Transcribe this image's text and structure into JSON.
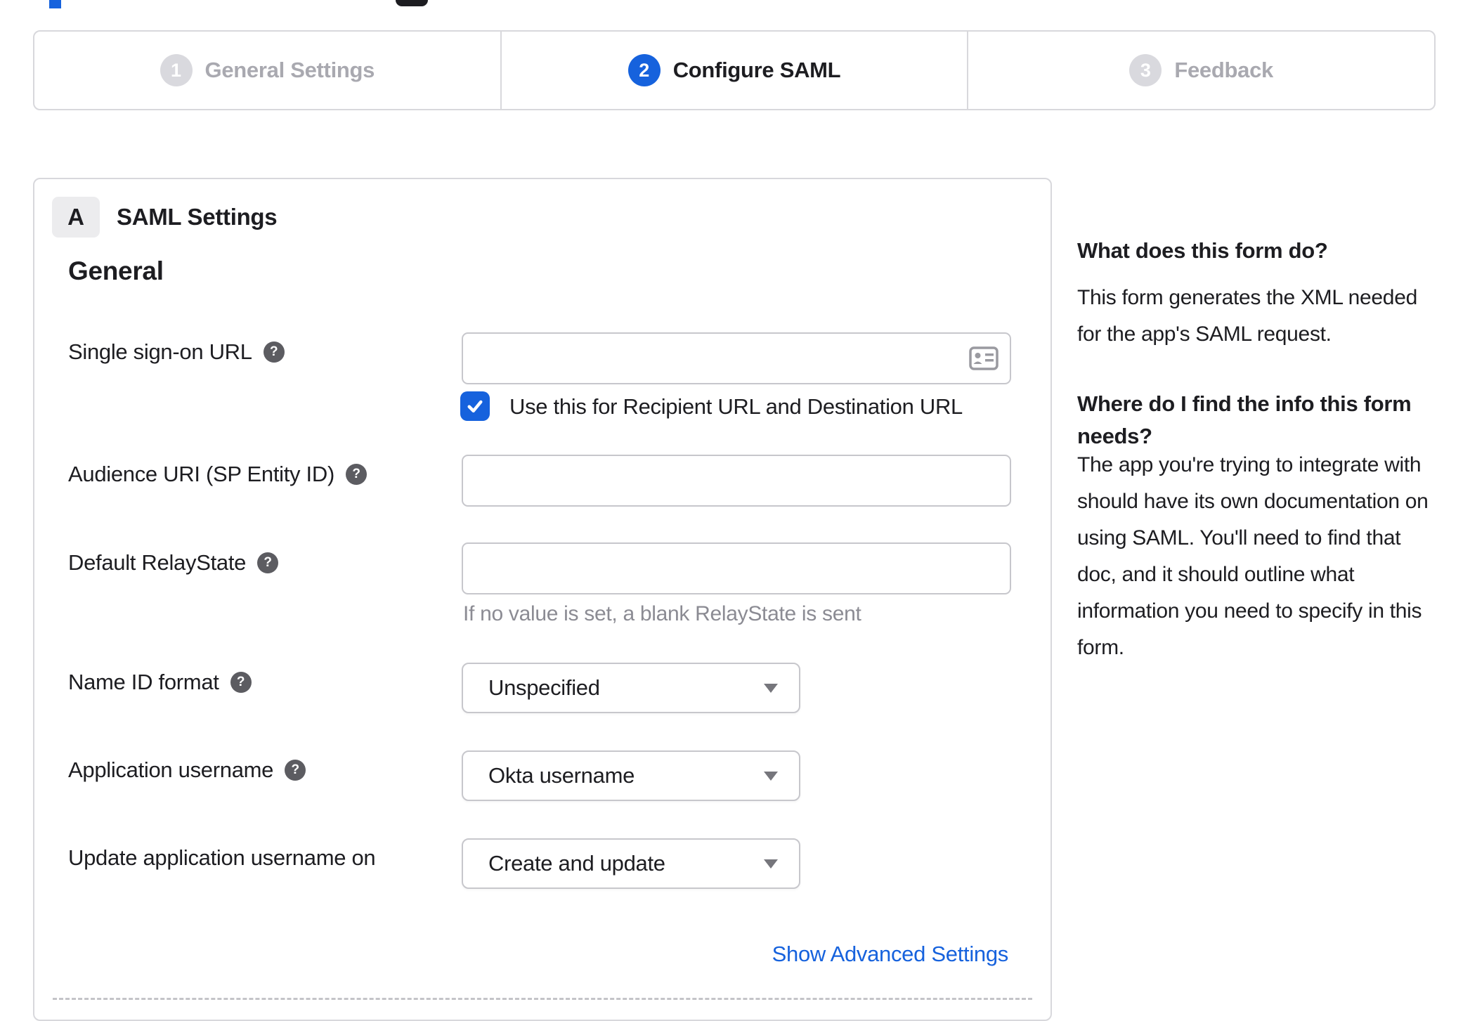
{
  "colors": {
    "accent_blue": "#1662dd",
    "step_inactive_gray": "#d9d9de",
    "border_gray": "#d8d8dc",
    "text_dark": "#1d1d21",
    "muted_gray": "#a9a9b0",
    "hint_gray": "#8b8b93",
    "link_blue": "#1662dd"
  },
  "stepper": {
    "steps": [
      {
        "number": "1",
        "label": "General Settings",
        "active": false
      },
      {
        "number": "2",
        "label": "Configure SAML",
        "active": true
      },
      {
        "number": "3",
        "label": "Feedback",
        "active": false
      }
    ]
  },
  "panel": {
    "badge": "A",
    "title": "SAML Settings",
    "section_heading": "General",
    "fields": [
      {
        "label": "Single sign-on URL",
        "type": "text",
        "value": "",
        "has_help": true,
        "checkbox_label": "Use this for Recipient URL and Destination URL",
        "checkbox_checked": true
      },
      {
        "label": "Audience URI (SP Entity ID)",
        "type": "text",
        "value": "",
        "has_help": true
      },
      {
        "label": "Default RelayState",
        "type": "text",
        "value": "",
        "has_help": true,
        "hint": "If no value is set, a blank RelayState is sent"
      },
      {
        "label": "Name ID format",
        "type": "select",
        "value": "Unspecified",
        "has_help": true
      },
      {
        "label": "Application username",
        "type": "select",
        "value": "Okta username",
        "has_help": true
      },
      {
        "label": "Update application username on",
        "type": "select",
        "value": "Create and update",
        "has_help": false
      }
    ],
    "advanced_link": "Show Advanced Settings"
  },
  "help": {
    "q1": "What does this form do?",
    "a1": "This form generates the XML needed for the app's SAML request.",
    "q2": "Where do I find the info this form needs?",
    "a2": "The app you're trying to integrate with should have its own documentation on using SAML. You'll need to find that doc, and it should outline what information you need to specify in this form."
  }
}
